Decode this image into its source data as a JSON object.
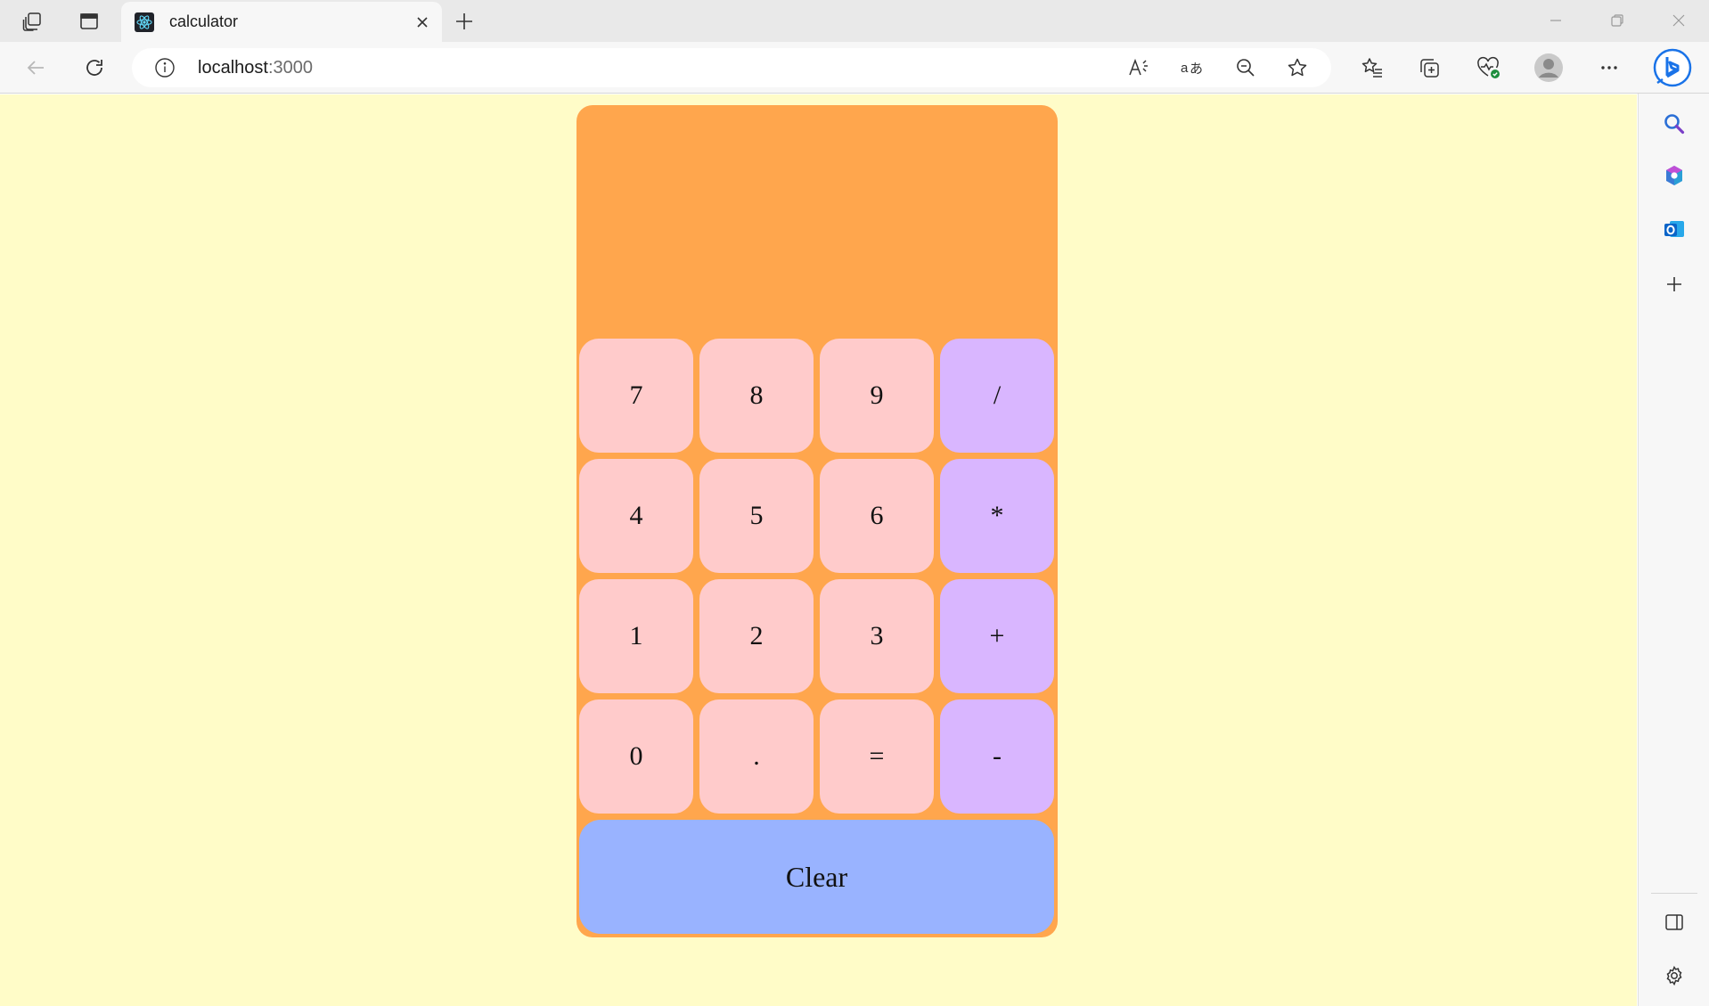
{
  "browser": {
    "tab": {
      "title": "calculator",
      "favicon": "react-icon"
    },
    "address": {
      "host": "localhost",
      "port": ":3000"
    },
    "icons": {
      "workspaces": "workspaces-icon",
      "tab_actions": "vertical-tabs-icon",
      "back": "back-arrow-icon",
      "refresh": "refresh-icon",
      "info": "site-info-icon",
      "read_aloud": "read-aloud-icon",
      "translate": "translate-icon",
      "zoom": "zoom-out-icon",
      "favorite": "star-icon",
      "favorites": "favorites-icon",
      "collections": "collections-icon",
      "performance": "browser-essentials-icon",
      "profile": "profile-avatar-icon",
      "more": "more-icon",
      "copilot": "bing-copilot-icon"
    },
    "sidebar_icons": [
      "search-icon",
      "office-icon",
      "outlook-icon",
      "add-icon",
      "sidebar-toggle-icon",
      "settings-icon"
    ]
  },
  "calculator": {
    "display": "",
    "rows": [
      [
        {
          "label": "7",
          "kind": "num"
        },
        {
          "label": "8",
          "kind": "num"
        },
        {
          "label": "9",
          "kind": "num"
        },
        {
          "label": "/",
          "kind": "op"
        }
      ],
      [
        {
          "label": "4",
          "kind": "num"
        },
        {
          "label": "5",
          "kind": "num"
        },
        {
          "label": "6",
          "kind": "num"
        },
        {
          "label": "*",
          "kind": "op"
        }
      ],
      [
        {
          "label": "1",
          "kind": "num"
        },
        {
          "label": "2",
          "kind": "num"
        },
        {
          "label": "3",
          "kind": "num"
        },
        {
          "label": "+",
          "kind": "op"
        }
      ],
      [
        {
          "label": "0",
          "kind": "num"
        },
        {
          "label": ".",
          "kind": "num"
        },
        {
          "label": "=",
          "kind": "num"
        },
        {
          "label": "-",
          "kind": "op"
        }
      ]
    ],
    "clear_label": "Clear"
  },
  "colors": {
    "page_background": "#fffcc8",
    "calculator_body": "#ffa64d",
    "number_key": "#ffcbcb",
    "operator_key": "#d9b6ff",
    "clear_key": "#99b3ff"
  }
}
